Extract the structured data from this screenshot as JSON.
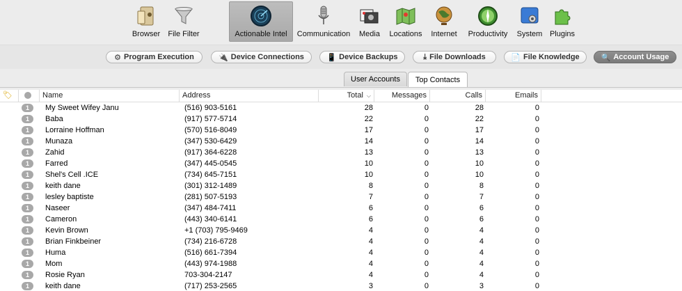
{
  "toolbar": {
    "items": [
      {
        "label": "Browser",
        "icon": "browser-icon"
      },
      {
        "label": "File Filter",
        "icon": "funnel-icon"
      },
      {
        "label": "Actionable Intel",
        "icon": "radar-icon",
        "active": true
      },
      {
        "label": "Communication",
        "icon": "microphone-icon"
      },
      {
        "label": "Media",
        "icon": "media-icon"
      },
      {
        "label": "Locations",
        "icon": "map-icon"
      },
      {
        "label": "Internet",
        "icon": "globe-icon"
      },
      {
        "label": "Productivity",
        "icon": "compass-icon"
      },
      {
        "label": "System",
        "icon": "system-icon"
      },
      {
        "label": "Plugins",
        "icon": "puzzle-icon"
      }
    ]
  },
  "categories": [
    {
      "label": "Program Execution",
      "icon": "program-execution-icon"
    },
    {
      "label": "Device Connections",
      "icon": "usb-icon"
    },
    {
      "label": "Device Backups",
      "icon": "phone-icon"
    },
    {
      "label": "File Downloads",
      "icon": "download-icon"
    },
    {
      "label": "File Knowledge",
      "icon": "document-icon"
    },
    {
      "label": "Account Usage",
      "icon": "account-icon",
      "active": true
    }
  ],
  "tabs": [
    {
      "label": "User Accounts"
    },
    {
      "label": "Top Contacts",
      "selected": true
    }
  ],
  "table": {
    "columns": {
      "name": "Name",
      "address": "Address",
      "total": "Total",
      "messages": "Messages",
      "calls": "Calls",
      "emails": "Emails"
    },
    "badge": "1",
    "rows": [
      {
        "name": "My Sweet Wifey Janu",
        "address": "(516) 903-5161",
        "total": "28",
        "messages": "0",
        "calls": "28",
        "emails": "0"
      },
      {
        "name": "Baba",
        "address": "(917) 577-5714",
        "total": "22",
        "messages": "0",
        "calls": "22",
        "emails": "0"
      },
      {
        "name": "Lorraine Hoffman",
        "address": "(570) 516-8049",
        "total": "17",
        "messages": "0",
        "calls": "17",
        "emails": "0"
      },
      {
        "name": "Munaza",
        "address": "(347) 530-6429",
        "total": "14",
        "messages": "0",
        "calls": "14",
        "emails": "0"
      },
      {
        "name": "Zahid",
        "address": "(917) 364-6228",
        "total": "13",
        "messages": "0",
        "calls": "13",
        "emails": "0"
      },
      {
        "name": "Farred",
        "address": "(347) 445-0545",
        "total": "10",
        "messages": "0",
        "calls": "10",
        "emails": "0"
      },
      {
        "name": "Shel's Cell .ICE",
        "address": "(734) 645-7151",
        "total": "10",
        "messages": "0",
        "calls": "10",
        "emails": "0"
      },
      {
        "name": "keith dane",
        "address": "(301) 312-1489",
        "total": "8",
        "messages": "0",
        "calls": "8",
        "emails": "0"
      },
      {
        "name": "lesley baptiste",
        "address": "(281) 507-5193",
        "total": "7",
        "messages": "0",
        "calls": "7",
        "emails": "0"
      },
      {
        "name": "Naseer",
        "address": "(347) 484-7411",
        "total": "6",
        "messages": "0",
        "calls": "6",
        "emails": "0"
      },
      {
        "name": "Cameron",
        "address": "(443) 340-6141",
        "total": "6",
        "messages": "0",
        "calls": "6",
        "emails": "0"
      },
      {
        "name": "Kevin Brown",
        "address": "+1 (703) 795-9469",
        "total": "4",
        "messages": "0",
        "calls": "4",
        "emails": "0"
      },
      {
        "name": "Brian Finkbeiner",
        "address": "(734) 216-6728",
        "total": "4",
        "messages": "0",
        "calls": "4",
        "emails": "0"
      },
      {
        "name": "Huma",
        "address": "(516) 661-7394",
        "total": "4",
        "messages": "0",
        "calls": "4",
        "emails": "0"
      },
      {
        "name": "Mom",
        "address": "(443) 974-1988",
        "total": "4",
        "messages": "0",
        "calls": "4",
        "emails": "0"
      },
      {
        "name": "Rosie Ryan",
        "address": "703-304-2147",
        "total": "4",
        "messages": "0",
        "calls": "4",
        "emails": "0"
      },
      {
        "name": "keith dane",
        "address": "(717) 253-2565",
        "total": "3",
        "messages": "0",
        "calls": "3",
        "emails": "0"
      }
    ]
  }
}
